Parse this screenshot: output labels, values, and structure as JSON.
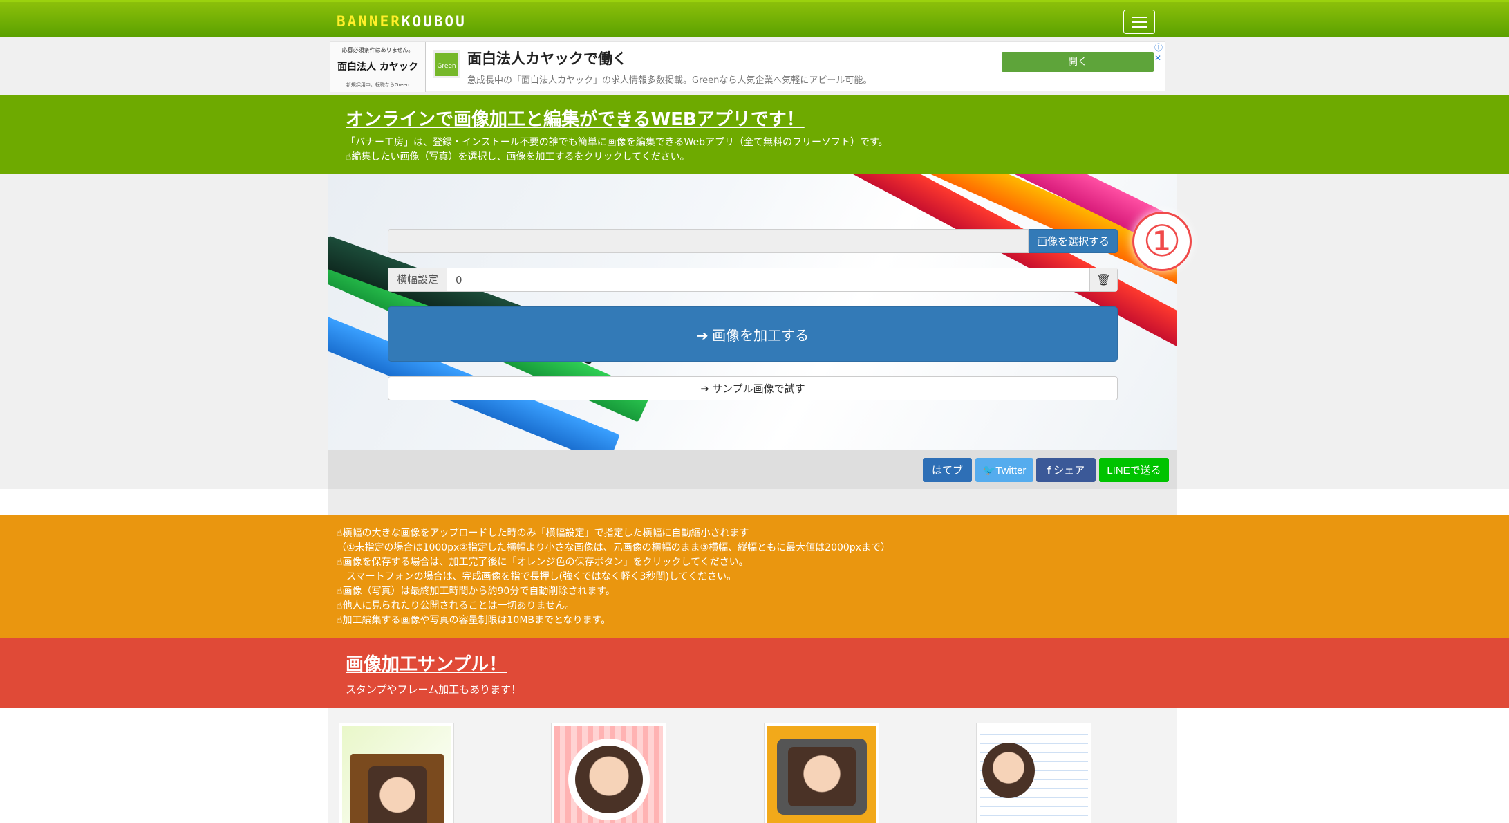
{
  "navbar": {
    "logo_part1": "BANNER",
    "logo_part2": "KOUBOU",
    "menu_icon": "hamburger-icon"
  },
  "ad": {
    "thumb_line1": "応募必須条件はありません。",
    "thumb_brand": "面白法人 カヤック",
    "thumb_line2": "新規採用中。転職ならGreen",
    "logo_text": "Green",
    "title": "面白法人カヤックで働く",
    "description": "急成長中の「面白法人カヤック」の求人情報多数掲載。Greenなら人気企業へ気軽にアピール可能。",
    "open_label": "開く",
    "close_label": "ⓘ ✕"
  },
  "intro": {
    "heading": "オンラインで画像加工と編集ができるWEBアプリです！",
    "line1": "「バナー工房」は、登録・インストール不要の誰でも簡単に画像を編集できるWebアプリ（全て無料のフリーソフト）です。",
    "line2": "☝編集したい画像（写真）を選択し、画像を加工するをクリックしてください。"
  },
  "form": {
    "step_number": "①",
    "file_button": "画像を選択する",
    "width_label": "横幅設定",
    "width_value": "0",
    "trash_icon": "🗑",
    "process_button": "➔ 画像を加工する",
    "sample_button": "➔ サンプル画像で試す"
  },
  "share": {
    "hatena": "はてブ",
    "twitter": "Twitter",
    "facebook": "シェア",
    "line": "LINEで送る"
  },
  "notes": [
    "☝横幅の大きな画像をアップロードした時のみ「横幅設定」で指定した横幅に自動縮小されます",
    "（①未指定の場合は1000px②指定した横幅より小さな画像は、元画像の横幅のまま③横幅、縦幅ともに最大値は2000pxまで）",
    "☝画像を保存する場合は、加工完了後に「オレンジ色の保存ボタン」をクリックしてください。",
    "　スマートフォンの場合は、完成画像を指で長押し(強くではなく軽く3秒間)してください。",
    "☝画像（写真）は最終加工時間から約90分で自動削除されます。",
    "☝他人に見られたり公開されることは一切ありません。",
    "☝加工編集する画像や写真の容量制限は10MBまでとなります。"
  ],
  "samples_section": {
    "heading": "画像加工サンプル！",
    "subtext": "スタンプやフレーム加工もあります！"
  },
  "colors": {
    "nav_green": "#6eaa00",
    "orange": "#ea960f",
    "red": "#e04a37",
    "primary_blue": "#337ab7"
  }
}
